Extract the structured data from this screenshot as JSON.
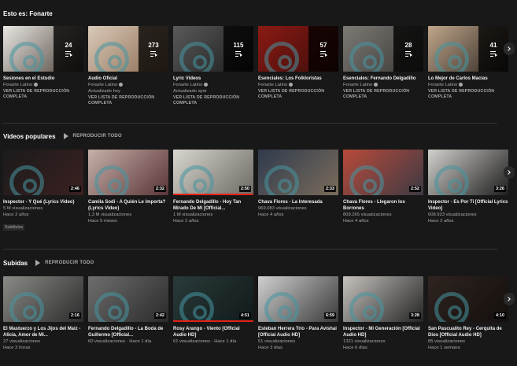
{
  "playlists": {
    "title": "Esto es: Fonarte",
    "items": [
      {
        "title": "Sesiones en el Estudio",
        "channel": "Fonarte Latino",
        "sub": "",
        "count": "24",
        "link": "VER LISTA DE REPRODUCCIÓN COMPLETA",
        "colors": [
          "#e9e6e2",
          "#4a4038"
        ]
      },
      {
        "title": "Audio Oficial",
        "channel": "Fonarte Latino",
        "sub": "Actualizado hoy",
        "count": "273",
        "link": "VER LISTA DE REPRODUCCIÓN COMPLETA",
        "colors": [
          "#d9c9b8",
          "#8a6a50"
        ]
      },
      {
        "title": "Lyric Videos",
        "channel": "Fonarte Latino",
        "sub": "Actualizado ayer",
        "count": "115",
        "link": "VER LISTA DE REPRODUCCIÓN COMPLETA",
        "colors": [
          "#5a5a5a",
          "#1a1a1a"
        ]
      },
      {
        "title": "Esenciales: Los Folkloristas",
        "channel": "Fonarte Latino",
        "sub": "",
        "count": "57",
        "link": "VER LISTA DE REPRODUCCIÓN COMPLETA",
        "colors": [
          "#8b1a14",
          "#3c0d0a"
        ]
      },
      {
        "title": "Esenciales: Fernando Delgadillo",
        "channel": "Fonarte Latino",
        "sub": "",
        "count": "28",
        "link": "VER LISTA DE REPRODUCCIÓN COMPLETA",
        "colors": [
          "#7d7a76",
          "#3a3633"
        ]
      },
      {
        "title": "Lo Mejor de Carlos Macias",
        "channel": "Fonarte Latino",
        "sub": "",
        "count": "41",
        "link": "VER LISTA DE REPRODUCCIÓN COMPLETA",
        "colors": [
          "#c0a58a",
          "#2a2520"
        ]
      }
    ]
  },
  "popular": {
    "title": "Videos populares",
    "play_all": "REPRODUCIR TODO",
    "items": [
      {
        "title": "Inspector - Y Qué (Lyrics Video)",
        "views": "5 M visualizaciones",
        "age": "Hace 2 años",
        "duration": "2:46",
        "badge": "Subtítulos",
        "progress": 0,
        "colors": [
          "#1b1b1b",
          "#3b2020"
        ]
      },
      {
        "title": "Camila Sodi - A Quién Le Importa? (Lyrics Video)",
        "views": "1,3 M visualizaciones",
        "age": "Hace 5 meses",
        "duration": "2:32",
        "badge": "",
        "progress": 0,
        "colors": [
          "#c6b0a8",
          "#5a3438"
        ]
      },
      {
        "title": "Fernando Delgadillo - Hoy Tan Mirado De Mí [Official...",
        "views": "1 M visualizaciones",
        "age": "Hace 2 años",
        "duration": "2:50",
        "badge": "",
        "progress": 100,
        "colors": [
          "#d9d6cf",
          "#6c6a63"
        ]
      },
      {
        "title": "Chava Flores - La Interesada",
        "views": "969.083 visualizaciones",
        "age": "Hace 4 años",
        "duration": "2:33",
        "badge": "",
        "progress": 0,
        "colors": [
          "#2f3a4d",
          "#7a6c5a"
        ]
      },
      {
        "title": "Chava Flores - Llegaron los Borrones",
        "views": "809.265 visualizaciones",
        "age": "Hace 4 años",
        "duration": "2:52",
        "badge": "",
        "progress": 0,
        "colors": [
          "#b84a3a",
          "#3e3a44"
        ]
      },
      {
        "title": "Inspector - Es Por Ti [Official Lyrics Video]",
        "views": "608.923 visualizaciones",
        "age": "Hace 2 años",
        "duration": "3:26",
        "badge": "",
        "progress": 0,
        "colors": [
          "#d2d0cc",
          "#1e1e1e"
        ]
      }
    ]
  },
  "uploads": {
    "title": "Subidas",
    "play_all": "REPRODUCIR TODO",
    "items": [
      {
        "title": "El Mastuerzo y Los Jijos del Maíz - Alicia, Amor de Mi...",
        "meta": "27 visualizaciones",
        "age": "Hace 3 horas",
        "duration": "2:16",
        "progress": 0,
        "colors": [
          "#8a8a86",
          "#2c2c2c"
        ]
      },
      {
        "title": "Fernando Delgadillo - La Boda de Guillermo [Official...",
        "meta": "60 visualizaciones · Hace 1 día",
        "age": "",
        "duration": "2:42",
        "progress": 0,
        "colors": [
          "#6e6e6e",
          "#2a2a2a"
        ]
      },
      {
        "title": "Rosy Arango - Viento [Official Audio HD]",
        "meta": "61 visualizaciones · Hace 1 día",
        "age": "",
        "duration": "4:51",
        "progress": 100,
        "colors": [
          "#2a3a3a",
          "#111a1a"
        ]
      },
      {
        "title": "Esteban Herrera Trío - Para Avishai [Official Audio HD]",
        "meta": "51 visualizaciones",
        "age": "Hace 3 días",
        "duration": "6:59",
        "progress": 0,
        "colors": [
          "#d0d0d0",
          "#3a3a3a"
        ]
      },
      {
        "title": "Inspector - Mi Generación [Official Audio HD]",
        "meta": "1321 visualizaciones",
        "age": "Hace 6 días",
        "duration": "3:28",
        "progress": 0,
        "colors": [
          "#c6c2be",
          "#242424"
        ]
      },
      {
        "title": "San Pascualito Rey - Cerquita de Dios [Official Audio HD]",
        "meta": "85 visualizaciones",
        "age": "Hace 1 semana",
        "duration": "4:10",
        "progress": 0,
        "colors": [
          "#2e2420",
          "#140f0d"
        ]
      }
    ]
  }
}
